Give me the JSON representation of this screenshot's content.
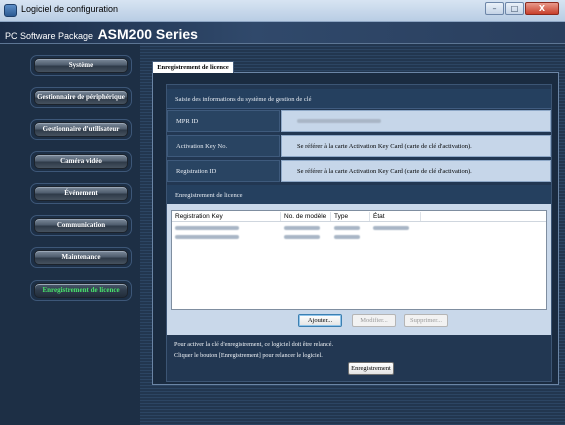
{
  "window": {
    "title": "Logiciel de configuration",
    "controls": {
      "minimize": "–",
      "maximize": "□",
      "close": "X"
    }
  },
  "header": {
    "product_prefix": "PC Software Package",
    "product_name": "ASM200 Series"
  },
  "sidebar": {
    "items": [
      {
        "label": "Système",
        "active": false
      },
      {
        "label": "Gestionnaire de périphérique",
        "active": false
      },
      {
        "label": "Gestionnaire d'utilisateur",
        "active": false
      },
      {
        "label": "Caméra vidéo",
        "active": false
      },
      {
        "label": "Événement",
        "active": false
      },
      {
        "label": "Communication",
        "active": false
      },
      {
        "label": "Maintenance",
        "active": false
      },
      {
        "label": "Enregistrement de licence",
        "active": true
      }
    ]
  },
  "main": {
    "tab_label": "Enregistrement de licence",
    "section_key_system": "Saisie des informations du système de gestion de clé",
    "mpr_id_label": "MPR ID",
    "mpr_id_value": "",
    "activation_key_label": "Activation Key No.",
    "activation_key_value": "Se référer à la carte Activation Key Card (carte de clé d'activation).",
    "registration_id_label": "Registration ID",
    "registration_id_value": "Se référer à la carte Activation Key Card (carte de clé d'activation).",
    "section_license": "Enregistrement de licence",
    "table": {
      "columns": [
        "Registration Key",
        "No. de modèle",
        "Type",
        "État"
      ],
      "rows": [
        [
          "",
          "",
          "",
          ""
        ],
        [
          "",
          "",
          "",
          ""
        ]
      ]
    },
    "buttons": {
      "add": "Ajouter...",
      "modify": "Modifier...",
      "delete": "Supprimer..."
    },
    "notes": [
      "Pour activer la clé d'enregistrement, ce logiciel doit être relancé.",
      "Cliquer le bouton [Enregistrement] pour relancer le logiciel."
    ],
    "register_button": "Enregistrement"
  },
  "colors": {
    "background": "#1a2a3e",
    "active_nav_text": "#47e36a",
    "value_cell": "#c6d6e9"
  }
}
